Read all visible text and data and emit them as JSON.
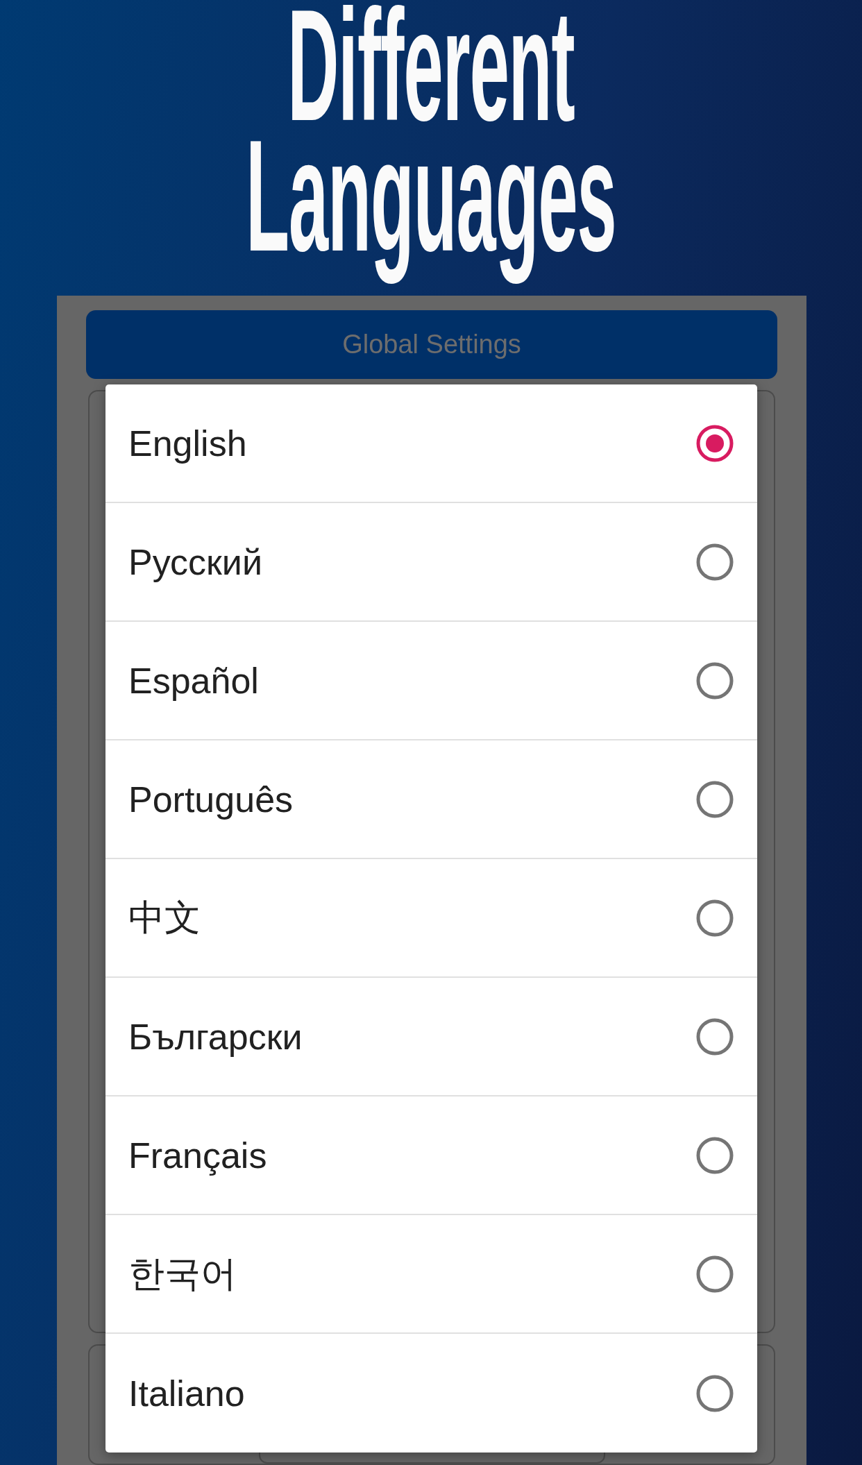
{
  "header": {
    "title": "Different Languages"
  },
  "settings_bar": {
    "title": "Global Settings"
  },
  "language_dialog": {
    "options": [
      {
        "label": "English",
        "selected": true
      },
      {
        "label": "Русский",
        "selected": false
      },
      {
        "label": "Español",
        "selected": false
      },
      {
        "label": "Português",
        "selected": false
      },
      {
        "label": "中文",
        "selected": false
      },
      {
        "label": "Български",
        "selected": false
      },
      {
        "label": "Français",
        "selected": false
      },
      {
        "label": "한국어",
        "selected": false
      },
      {
        "label": "Italiano",
        "selected": false
      }
    ]
  }
}
